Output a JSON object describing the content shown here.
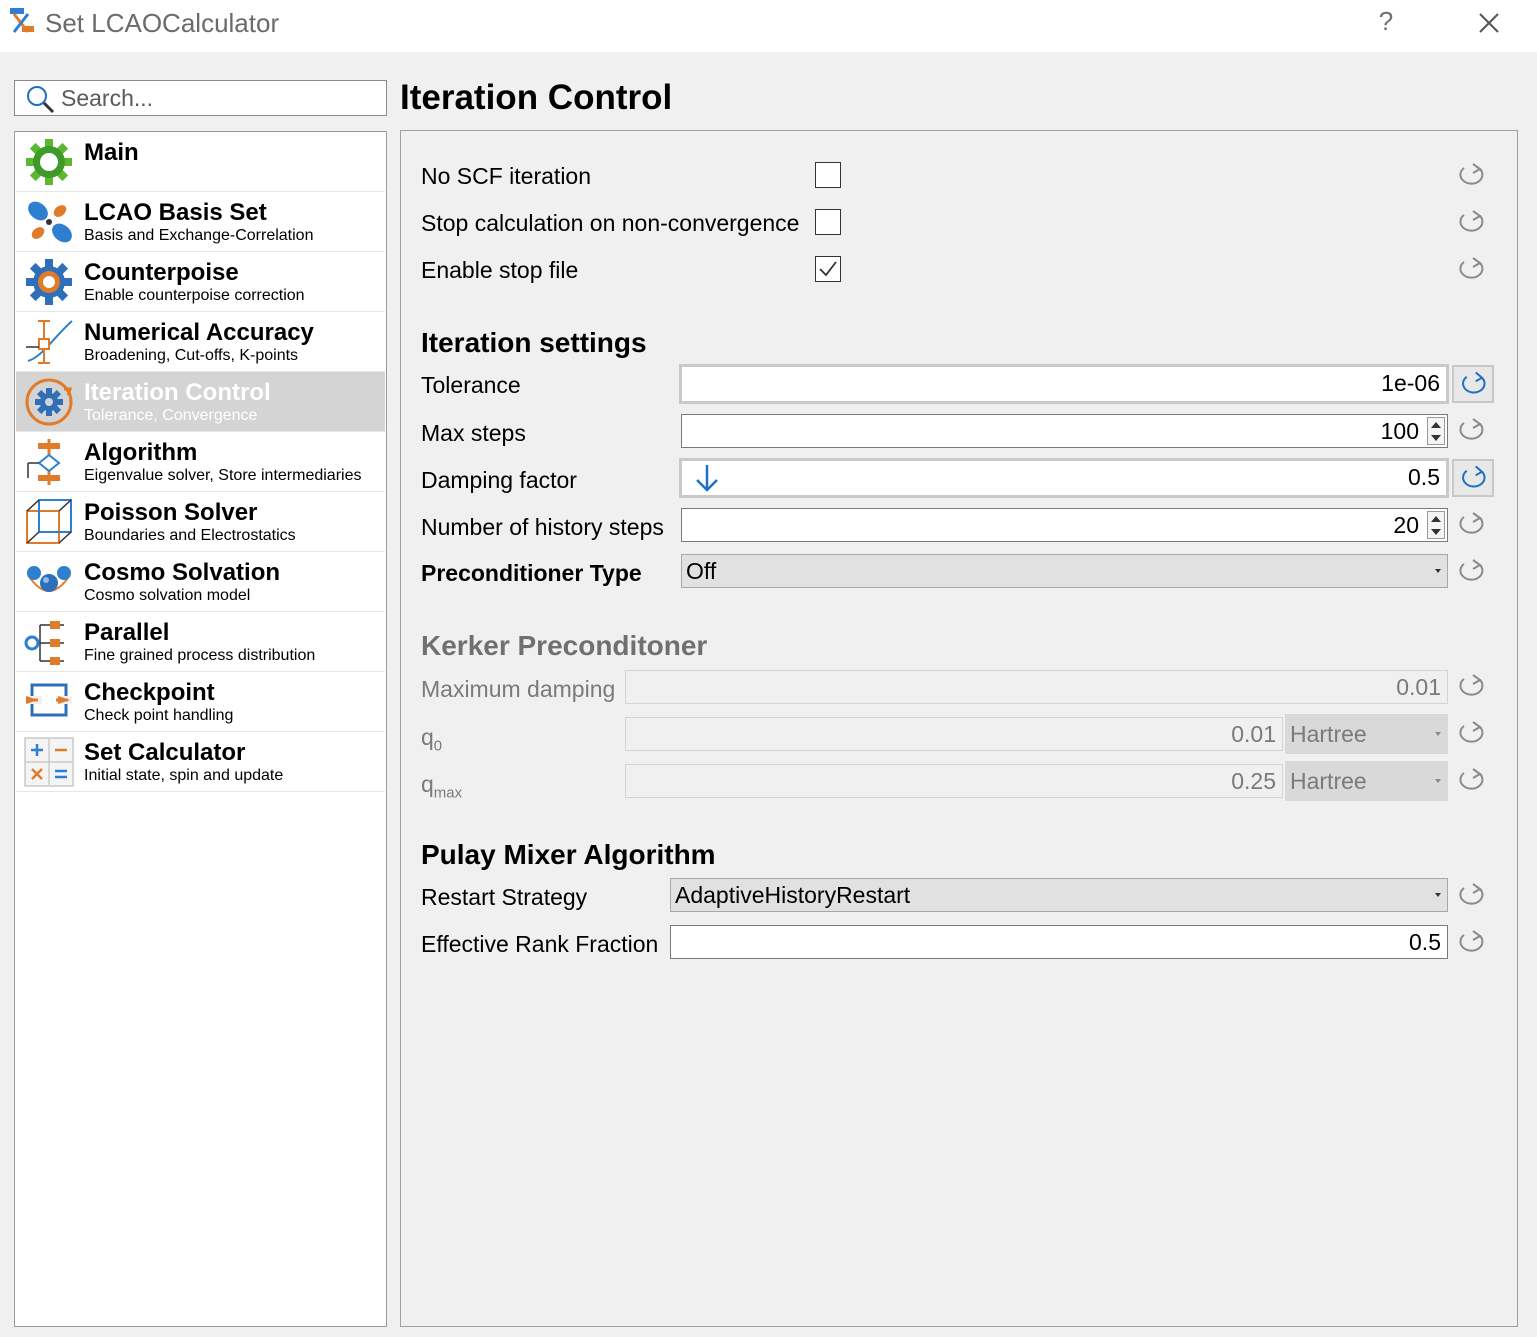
{
  "window": {
    "title": "Set LCAOCalculator",
    "help_label": "?"
  },
  "search": {
    "placeholder": "Search..."
  },
  "sidebar": {
    "items": [
      {
        "label": "Main",
        "sub": ""
      },
      {
        "label": "LCAO Basis Set",
        "sub": "Basis and Exchange-Correlation"
      },
      {
        "label": "Counterpoise",
        "sub": "Enable counterpoise correction"
      },
      {
        "label": "Numerical Accuracy",
        "sub": "Broadening, Cut-offs, K-points"
      },
      {
        "label": "Iteration Control",
        "sub": "Tolerance, Convergence"
      },
      {
        "label": "Algorithm",
        "sub": "Eigenvalue solver, Store intermediaries"
      },
      {
        "label": "Poisson Solver",
        "sub": "Boundaries and Electrostatics"
      },
      {
        "label": "Cosmo Solvation",
        "sub": "Cosmo solvation model"
      },
      {
        "label": "Parallel",
        "sub": "Fine grained process distribution"
      },
      {
        "label": "Checkpoint",
        "sub": "Check point handling"
      },
      {
        "label": "Set Calculator",
        "sub": "Initial state, spin  and update"
      }
    ],
    "selected_index": 4
  },
  "main": {
    "title": "Iteration Control",
    "checkboxes": [
      {
        "label": "No SCF iteration",
        "checked": false
      },
      {
        "label": "Stop calculation on non-convergence",
        "checked": false
      },
      {
        "label": "Enable stop file",
        "checked": true
      }
    ],
    "iteration_settings": {
      "heading": "Iteration settings",
      "tolerance": {
        "label": "Tolerance",
        "value": "1e-06"
      },
      "max_steps": {
        "label": "Max steps",
        "value": "100"
      },
      "damping_factor": {
        "label": "Damping factor",
        "value": "0.5"
      },
      "history_steps": {
        "label": "Number of history steps",
        "value": "20"
      },
      "preconditioner": {
        "label": "Preconditioner Type",
        "value": "Off"
      }
    },
    "kerker": {
      "heading": "Kerker Preconditoner",
      "max_damping": {
        "label": "Maximum damping",
        "value": "0.01"
      },
      "q0": {
        "label": "q",
        "sub": "0",
        "value": "0.01",
        "unit": "Hartree"
      },
      "qmax": {
        "label": "q",
        "sub": "max",
        "value": "0.25",
        "unit": "Hartree"
      }
    },
    "pulay": {
      "heading": "Pulay Mixer Algorithm",
      "restart_strategy": {
        "label": "Restart Strategy",
        "value": "AdaptiveHistoryRestart"
      },
      "rank_fraction": {
        "label": "Effective Rank Fraction",
        "value": "0.5"
      }
    }
  },
  "colors": {
    "accent": "#1e6fc8",
    "selected": "#d4d4d4",
    "orange": "#d2691e",
    "green": "#4caf50"
  }
}
